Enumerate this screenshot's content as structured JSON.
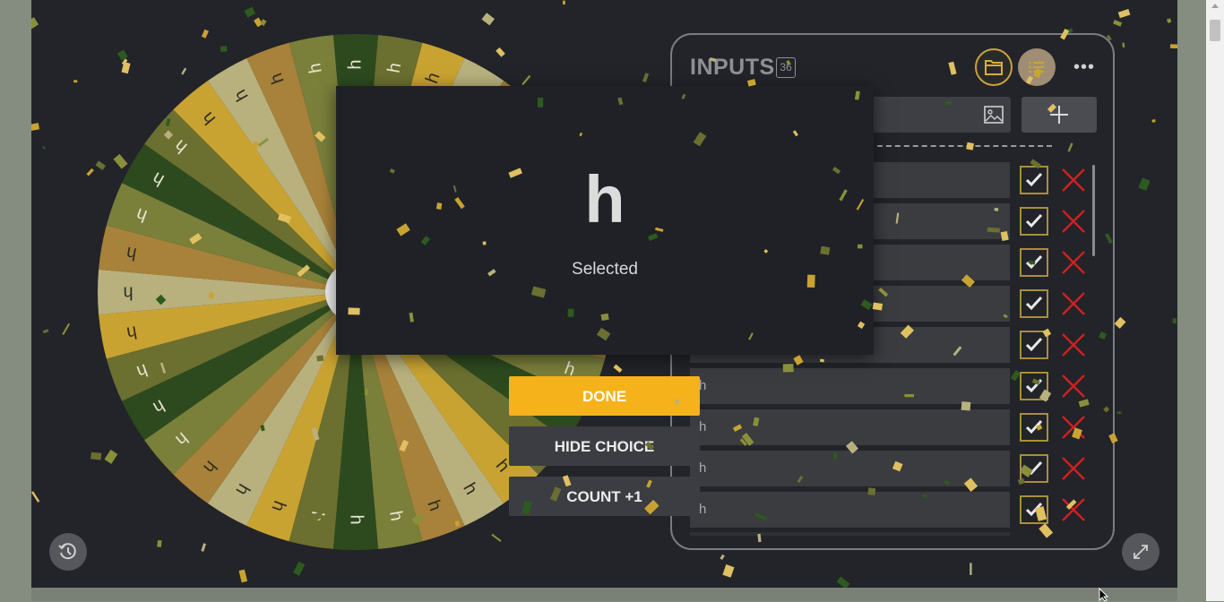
{
  "wheel": {
    "segment_label": "h",
    "segment_count": 36,
    "colors": [
      "#2d4a1f",
      "#6b6f2f",
      "#c9a332",
      "#b8b17e",
      "#a8823a",
      "#7a7f3a"
    ]
  },
  "panel": {
    "title": "INPUTS",
    "count": "36",
    "input_placeholder": "",
    "entries": [
      {
        "label": "h"
      },
      {
        "label": "h"
      },
      {
        "label": "h"
      },
      {
        "label": "h"
      },
      {
        "label": "h"
      },
      {
        "label": "h"
      },
      {
        "label": "h"
      },
      {
        "label": "h"
      },
      {
        "label": "h"
      }
    ]
  },
  "dialog": {
    "result": "h",
    "label": "Selected"
  },
  "actions": {
    "done": "DONE",
    "hide": "HIDE CHOICE",
    "count": "COUNT +1"
  },
  "icons": {
    "folder": "folder-icon",
    "list": "list-icon",
    "more": "more-icon",
    "image": "image-icon",
    "add": "plus-icon",
    "check": "check-icon",
    "delete": "close-icon",
    "history": "history-icon",
    "expand": "expand-icon"
  },
  "colors": {
    "accent": "#f5b21b",
    "background": "#222429",
    "check": "#a88f3a",
    "delete": "#d02020"
  }
}
